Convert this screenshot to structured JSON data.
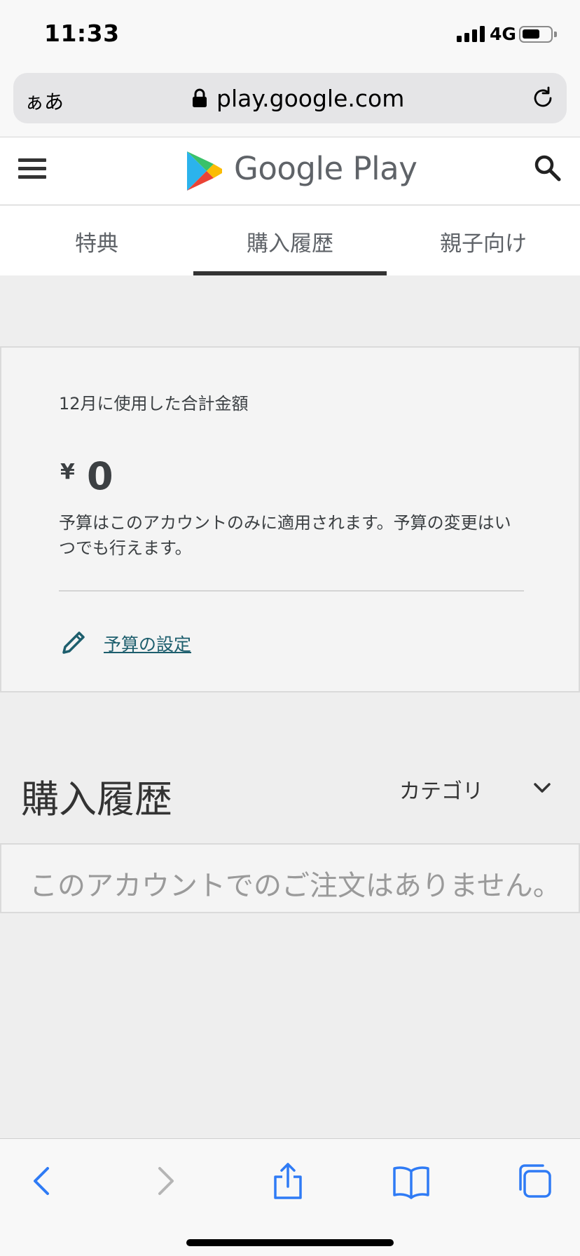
{
  "status_bar": {
    "time": "11:33",
    "network": "4G"
  },
  "browser": {
    "text_size_label": "ぁあ",
    "url": "play.google.com"
  },
  "header": {
    "title": "Google Play"
  },
  "tabs": [
    {
      "label": "特典",
      "active": false
    },
    {
      "label": "購入履歴",
      "active": true
    },
    {
      "label": "親子向け",
      "active": false
    }
  ],
  "budget": {
    "title": "12月に使用した合計金額",
    "currency": "¥",
    "amount": "0",
    "note": "予算はこのアカウントのみに適用されます。予算の変更はいつでも行えます。",
    "link": "予算の設定"
  },
  "history": {
    "title": "購入履歴",
    "category_selected": "カテゴリ",
    "empty_message": "このアカウントでのご注文はありません。"
  },
  "colors": {
    "link": "#1d5e6d",
    "accent_dark": "#333333",
    "safari_blue": "#2f7bf5"
  }
}
